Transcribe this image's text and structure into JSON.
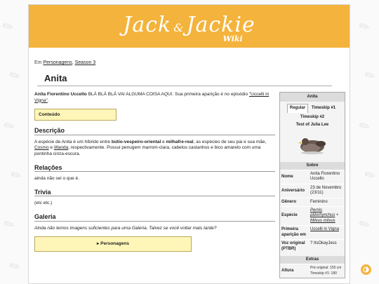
{
  "wiki": {
    "logo_part1": "Jack",
    "logo_amp": "&",
    "logo_part2": "Jackie",
    "logo_sub": "Wiki"
  },
  "breadcrumb": {
    "prefix": "Em",
    "link1": "Personagens",
    "sep": ",",
    "link2": "Season 3"
  },
  "page": {
    "title": "Anita"
  },
  "intro": {
    "name": "Anita Fiorentino Uccello",
    "text": " BLÁ BLÁ BLÁ VAI ALGUMA COISA AQUI. Sua primeira aparição é no episódio ",
    "episode_link": "\"Uccelli in Vigna\"",
    "end": "."
  },
  "toc": {
    "label": "Conteúdo"
  },
  "sections": {
    "descricao": {
      "heading": "Descrição",
      "text1": "A espécie de Anita é um híbrido entre ",
      "bold1": "bútio-vespeiro-oriental",
      "text2": " e ",
      "bold2": "milhafre-real",
      "text3": ", as espécies de seu pai e sua mãe, ",
      "link1": "Cosmo",
      "text4": " e ",
      "link2": "Wanda",
      "text5": ", respectivamente. Possui penugem marrom-clara, cabelos castanhos e bico amarelo com uma pontinha cinza-escura."
    },
    "relacoes": {
      "heading": "Relações",
      "text": "ainda não sei o que é."
    },
    "trivia": {
      "heading": "Trivia",
      "text": "(etc etc.)"
    },
    "galeria": {
      "heading": "Galeria",
      "text": "Ainda não temos imagens suficientes para uma Galeria. Talvez se você voltar mais tarde?"
    }
  },
  "navbox": {
    "label": "▸ Personagens"
  },
  "infobox": {
    "title": "Anita",
    "tabs": [
      "Regular",
      "Timeskip #1",
      "Timeskip #2",
      "Test of Julia Lee"
    ],
    "section_sobre": "Sobre",
    "rows": [
      {
        "label": "Nome",
        "value": "Anita Fiorentino Uccello"
      },
      {
        "label": "Aniversário",
        "value": "23 de Novembro (23/11)"
      },
      {
        "label": "Gênero",
        "value": "Feminino"
      },
      {
        "label": "Espécie",
        "link1": "Pernis ptilorhynchus",
        "sep": " + ",
        "link2": "Milvus milvus"
      },
      {
        "label": "Primeira aparição em",
        "link1": "Uccelli in Vigna"
      },
      {
        "label": "Voz original (PTBR)",
        "value": "? ItsOkayJess"
      }
    ],
    "section_extras": "Extras",
    "altura": {
      "label": "Altura",
      "line1": "Pré original: 150 cm",
      "line2": "Timeskip #1: 180"
    }
  },
  "colors": {
    "header": "#f4b33c",
    "toc_bg": "#fef6b8"
  },
  "icons": {
    "theme_toggle": "half-circle-icon",
    "background": "feather-icon"
  }
}
